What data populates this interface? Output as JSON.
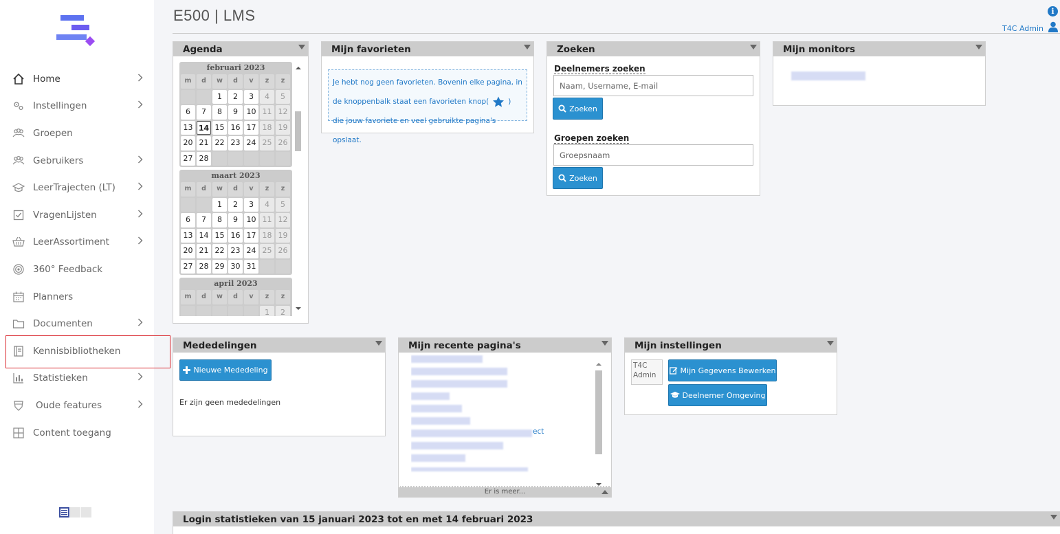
{
  "header": {
    "title": "E500 | LMS",
    "user": "T4C Admin"
  },
  "sidebar": {
    "items": [
      {
        "label": "Home",
        "icon": "home-icon",
        "chevron": true
      },
      {
        "label": "Instellingen",
        "icon": "settings-icon",
        "chevron": true
      },
      {
        "label": "Groepen",
        "icon": "users-group-icon",
        "chevron": false
      },
      {
        "label": "Gebruikers",
        "icon": "users-icon",
        "chevron": true
      },
      {
        "label": "LeerTrajecten (LT)",
        "icon": "graduation-cap-icon",
        "chevron": true
      },
      {
        "label": "VragenLijsten",
        "icon": "checkbox-icon",
        "chevron": true
      },
      {
        "label": "LeerAssortiment",
        "icon": "basket-icon",
        "chevron": true
      },
      {
        "label": "360° Feedback",
        "icon": "target-icon",
        "chevron": false
      },
      {
        "label": "Planners",
        "icon": "calendar-icon",
        "chevron": false
      },
      {
        "label": "Documenten",
        "icon": "folder-icon",
        "chevron": true
      },
      {
        "label": "Kennisbibliotheken",
        "icon": "book-icon",
        "chevron": false
      },
      {
        "label": "Statistieken",
        "icon": "bar-chart-icon",
        "chevron": true
      },
      {
        "label": "Oude features",
        "icon": "shield-icon",
        "chevron": true
      },
      {
        "label": "Content toegang",
        "icon": "grid-icon",
        "chevron": false
      }
    ]
  },
  "agenda": {
    "title": "Agenda",
    "weekdays": [
      "m",
      "d",
      "w",
      "d",
      "v",
      "z",
      "z"
    ],
    "months": [
      {
        "name": "februari  2023",
        "offset": 2,
        "days": 28,
        "today": 14
      },
      {
        "name": "maart  2023",
        "offset": 2,
        "days": 31,
        "today": null
      },
      {
        "name": "april  2023",
        "offset": 5,
        "days": 2,
        "today": null
      }
    ]
  },
  "favorieten": {
    "title": "Mijn favorieten",
    "text_before": "Je hebt nog geen favorieten. Bovenin elke pagina, in de knoppenbalk staat een favorieten knop(",
    "text_after": ") die jouw favoriete en veel gebruikte pagina's opslaat."
  },
  "zoeken": {
    "title": "Zoeken",
    "deelnemers_label": "Deelnemers zoeken",
    "deelnemers_placeholder": "Naam, Username, E-mail",
    "groepen_label": "Groepen zoeken",
    "groepen_placeholder": "Groepsnaam",
    "button": "Zoeken"
  },
  "monitors": {
    "title": "Mijn monitors"
  },
  "mededelingen": {
    "title": "Mededelingen",
    "new_button": "Nieuwe Mededeling",
    "empty_text": "Er zijn geen mededelingen"
  },
  "recent": {
    "title": "Mijn recente pagina's",
    "visible_suffix": "ect",
    "more": "Er is meer..."
  },
  "instellingen": {
    "title": "Mijn instellingen",
    "avatar_alt": "T4C Admin",
    "edit_button": "Mijn Gegevens Bewerken",
    "env_button": "Deelnemer Omgeving"
  },
  "login_stats": {
    "title": "Login statistieken van 15 januari 2023 tot en met 14 februari 2023"
  },
  "colors": {
    "accent": "#2b91d0",
    "link": "#2179c7",
    "panel_header": "#cccccc",
    "highlight": "#d9262c"
  }
}
